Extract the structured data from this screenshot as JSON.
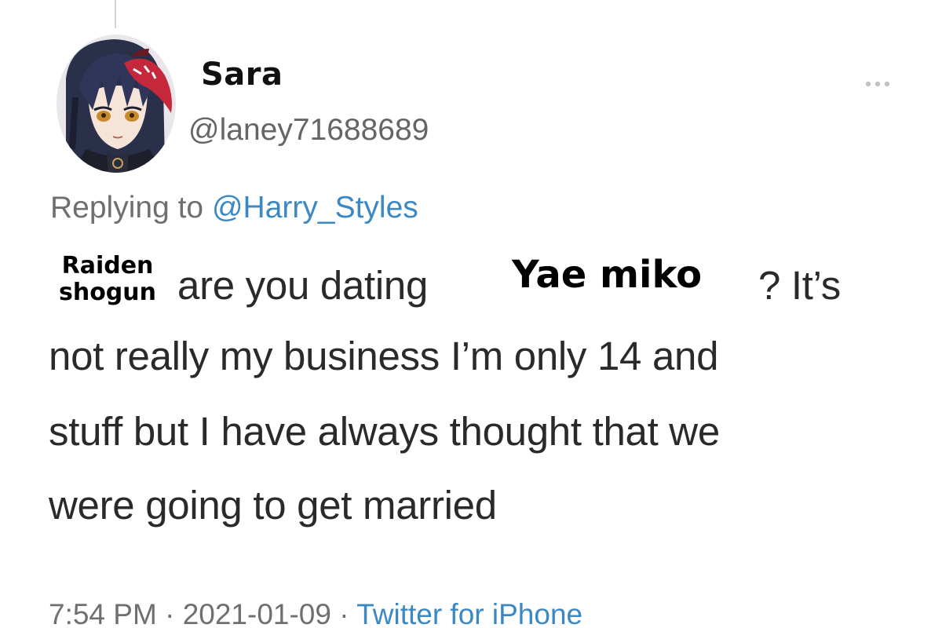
{
  "tweet": {
    "display_name": "Sara",
    "handle": "@laney71688689",
    "replying_to_prefix": "Replying to",
    "replying_to_user": "@Harry_Styles",
    "text_line1_part1": "are you dating",
    "text_line1_part2": "? It’s",
    "text_line2": "not really my business I’m only 14 and",
    "text_line3": "stuff but I have always thought that we",
    "text_line4": "were going to get married",
    "time": "7:54 PM",
    "date": "2021-01-09",
    "separator": "·",
    "source": "Twitter for iPhone"
  },
  "overlays": {
    "left_label": "Raiden\nshogun",
    "middle_label": "Yae miko"
  },
  "icons": {
    "avatar": "anime-character-avatar",
    "more": "more-options-icon"
  },
  "colors": {
    "link": "#3b88c3",
    "secondary_text": "#6f6f6f",
    "thread_line": "#cfd5da"
  }
}
